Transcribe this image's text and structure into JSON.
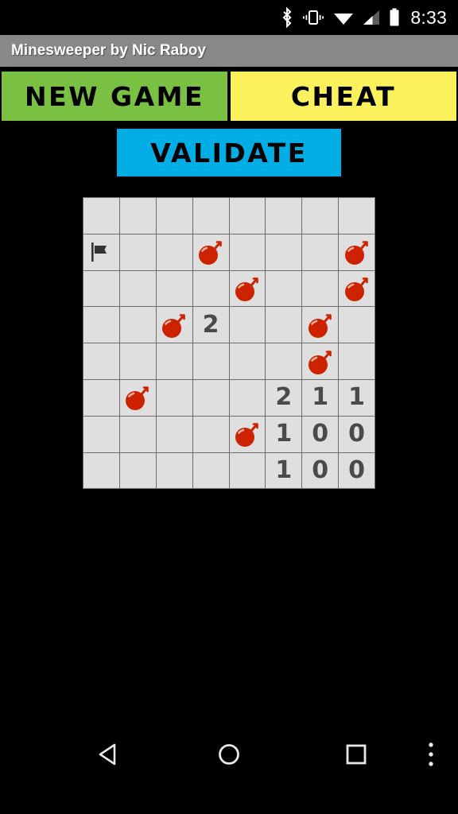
{
  "status_bar": {
    "time": "8:33",
    "icons": [
      "bluetooth-icon",
      "vibrate-icon",
      "wifi-icon",
      "cellular-signal-icon",
      "battery-icon"
    ],
    "background": "#000000"
  },
  "title_bar": {
    "title": "Minesweeper by Nic Raboy",
    "background": "#888888",
    "text_color": "#ffffff"
  },
  "buttons": {
    "new_game": {
      "label": "NEW GAME",
      "color": "#7ac143"
    },
    "cheat": {
      "label": "CHEAT",
      "color": "#fbf15c"
    },
    "validate": {
      "label": "VALIDATE",
      "color": "#00ade4"
    }
  },
  "board": {
    "rows": 8,
    "cols": 8,
    "cell_background": "#dfdfdf",
    "grid_line_color": "#6e6e6e",
    "bomb_color": "#cc2200",
    "flag_color": "#333333",
    "number_color": "#4a4a4a",
    "cells": [
      [
        "",
        "",
        "",
        "",
        "",
        "",
        "",
        ""
      ],
      [
        "flag",
        "",
        "",
        "bomb",
        "",
        "",
        "",
        "bomb"
      ],
      [
        "",
        "",
        "",
        "",
        "bomb",
        "",
        "",
        "bomb"
      ],
      [
        "",
        "",
        "bomb",
        "2",
        "",
        "",
        "bomb",
        ""
      ],
      [
        "",
        "",
        "",
        "",
        "",
        "",
        "bomb",
        ""
      ],
      [
        "",
        "bomb",
        "",
        "",
        "",
        "2",
        "1",
        "1"
      ],
      [
        "",
        "",
        "",
        "",
        "bomb",
        "1",
        "0",
        "0"
      ],
      [
        "",
        "",
        "",
        "",
        "",
        "1",
        "0",
        "0"
      ]
    ]
  },
  "nav_bar": {
    "back_label": "back-icon",
    "home_label": "home-icon",
    "recents_label": "recents-icon",
    "more_label": "overflow-menu-icon"
  }
}
